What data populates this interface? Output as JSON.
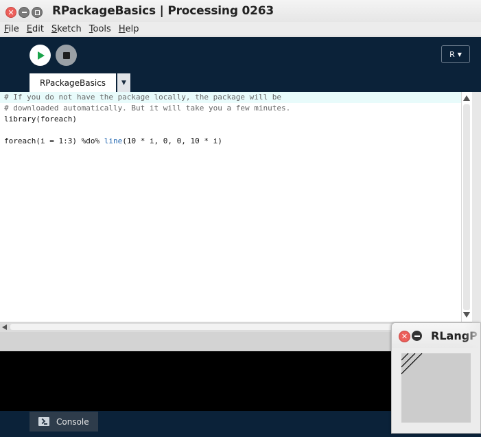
{
  "window": {
    "title": "RPackageBasics | Processing 0263",
    "close_glyph": "✕"
  },
  "menu": {
    "items": [
      {
        "accel": "F",
        "rest": "ile"
      },
      {
        "accel": "E",
        "rest": "dit"
      },
      {
        "accel": "S",
        "rest": "ketch"
      },
      {
        "accel": "T",
        "rest": "ools"
      },
      {
        "accel": "H",
        "rest": "elp"
      }
    ]
  },
  "toolbar": {
    "mode_label": "R",
    "mode_arrow": "▼"
  },
  "tabs": {
    "active_tab": "RPackageBasics",
    "menu_arrow": "▼"
  },
  "editor": {
    "line1": "# If you do not have the package locally, the package will be",
    "line2": "# downloaded automatically. But it will take you a few minutes.",
    "line3": "library(foreach)",
    "line5_a": "foreach(i = 1:3) %do% ",
    "line5_kw": "line",
    "line5_b": "(10 * i, 0, 0, 10 * i)"
  },
  "console": {
    "tab_label": "Console"
  },
  "sketch_window": {
    "title": "RLangP",
    "close_glyph": "✕"
  },
  "colors": {
    "toolbar_bg": "#0b2239",
    "run_arrow": "#1aa34a",
    "current_line": "#e8fbfb",
    "keyword": "#2166b0",
    "close_red": "#ec5f5a"
  }
}
